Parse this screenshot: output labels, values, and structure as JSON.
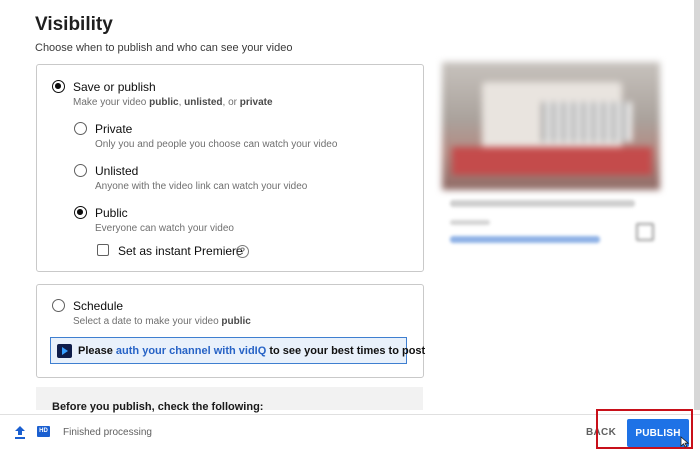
{
  "header": {
    "title": "Visibility",
    "subtitle": "Choose when to publish and who can see your video"
  },
  "save_or_publish": {
    "label": "Save or publish",
    "desc_prefix": "Make your video ",
    "desc_public": "public",
    "desc_sep1": ", ",
    "desc_unlisted": "unlisted",
    "desc_sep2": ", or ",
    "desc_private": "private",
    "selected": true,
    "options": [
      {
        "label": "Private",
        "description": "Only you and people you choose can watch your video",
        "selected": false
      },
      {
        "label": "Unlisted",
        "description": "Anyone with the video link can watch your video",
        "selected": false
      },
      {
        "label": "Public",
        "description": "Everyone can watch your video",
        "selected": true
      }
    ],
    "premiere": {
      "label": "Set as instant Premiere",
      "checked": false,
      "help_glyph": "?"
    }
  },
  "schedule": {
    "label": "Schedule",
    "desc_prefix": "Select a date to make your video ",
    "desc_bold": "public",
    "selected": false
  },
  "vidiq": {
    "icon": "vidiq-logo-icon",
    "prefix": "Please ",
    "link": "auth your channel with vidIQ",
    "suffix": " to see your best times to post"
  },
  "checklist": {
    "title": "Before you publish, check the following:"
  },
  "footer": {
    "hd_badge": "HD",
    "status": "Finished processing",
    "back_label": "BACK",
    "publish_label": "PUBLISH"
  },
  "colors": {
    "accent": "#1e72e6",
    "highlight": "#c8101a",
    "link": "#2763c6"
  }
}
